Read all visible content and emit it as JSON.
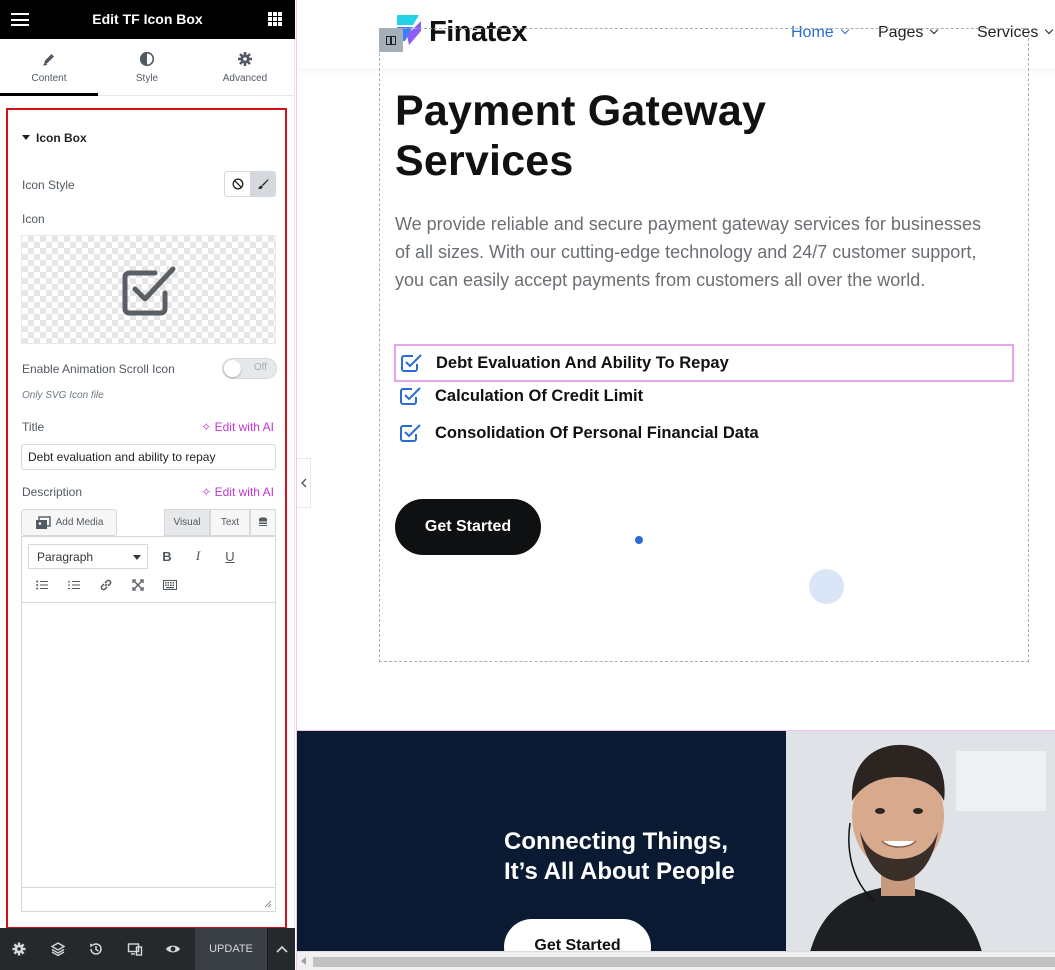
{
  "panel": {
    "header_title": "Edit TF Icon Box",
    "tabs": [
      {
        "label": "Content",
        "icon": "pencil-icon"
      },
      {
        "label": "Style",
        "icon": "half-circle-icon"
      },
      {
        "label": "Advanced",
        "icon": "gear-icon"
      }
    ],
    "section_title": "Icon Box",
    "icon_style_label": "Icon Style",
    "icon_label": "Icon",
    "animation_label": "Enable Animation Scroll Icon",
    "animation_toggle": "Off",
    "animation_hint": "Only SVG Icon file",
    "title_label": "Title",
    "edit_with_ai": "Edit with AI",
    "title_value": "Debt evaluation and ability to repay",
    "description_label": "Description",
    "add_media": "Add Media",
    "editor_tabs": {
      "visual": "Visual",
      "text": "Text"
    },
    "paragraph_select": "Paragraph",
    "footer": {
      "update": "UPDATE"
    }
  },
  "site": {
    "brand": "Finatex",
    "nav": [
      {
        "label": "Home",
        "active": true
      },
      {
        "label": "Pages",
        "active": false
      },
      {
        "label": "Services",
        "active": false
      }
    ],
    "hero": {
      "title": "Payment Gateway Services",
      "description": "We provide reliable and secure payment gateway services for businesses of all sizes. With our cutting-edge technology and 24/7 customer support, you can easily accept payments from customers all over the world.",
      "features": [
        "Debt Evaluation And Ability To Repay",
        "Calculation Of Credit Limit",
        "Consolidation Of Personal Financial Data"
      ],
      "cta": "Get Started"
    },
    "banner": {
      "heading_line1": "Connecting Things,",
      "heading_line2": "It’s All About People",
      "cta": "Get Started"
    }
  },
  "colors": {
    "accent": "#2a6bd6",
    "section_outline": "#d40e14",
    "ai_magenta": "#c036d3",
    "dark_navy": "#0b1a33"
  }
}
